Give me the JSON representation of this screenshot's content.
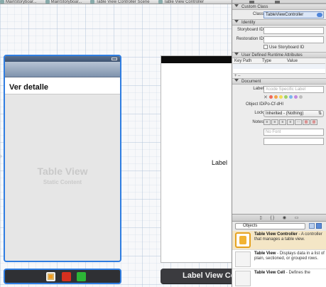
{
  "tabbar": {
    "items": [
      "MainStoryboar...",
      "MainStoryboar...",
      "Table View Controller Scene",
      "Table View Controller"
    ]
  },
  "scene1": {
    "cell_title": "Ver detalle",
    "placeholder_title": "Table View",
    "placeholder_subtitle": "Static Content"
  },
  "scene2": {
    "label_text": "Label",
    "dock_title": "Label View Con"
  },
  "inspector": {
    "custom_class": {
      "header": "Custom Class",
      "class_label": "Class",
      "class_value": "TableViewController"
    },
    "identity": {
      "header": "Identity",
      "storyboard_id_label": "Storyboard ID",
      "storyboard_id_value": "",
      "restoration_id_label": "Restoration ID",
      "restoration_id_value": "",
      "use_storyboard_id_label": "Use Storyboard ID"
    },
    "udra": {
      "header": "User Defined Runtime Attributes",
      "columns": [
        "Key Path",
        "Type",
        "Value"
      ],
      "add_remove": "+ –"
    },
    "document": {
      "header": "Document",
      "label_label": "Label",
      "label_placeholder": "Xcode Specific Label",
      "object_id_label": "Object ID",
      "object_id_value": "iPo-Cf-dHI",
      "lock_label": "Lock",
      "lock_value": "Inherited - (Nothing)",
      "notes_label": "Notes",
      "font_placeholder": "No Font",
      "label_colors": [
        "#f06a5a",
        "#f4a34a",
        "#f2dc55",
        "#9fd266",
        "#7ab4ef",
        "#c08ae0",
        "#bdbdbd"
      ]
    }
  },
  "library": {
    "filter_value": "Objects",
    "items": [
      {
        "name": "Table View Controller",
        "desc": " - A controller that manages a table view."
      },
      {
        "name": "Table View",
        "desc": " - Displays data in a list of plain, sectioned, or grouped rows."
      },
      {
        "name": "Table View Cell",
        "desc": " - Defines the"
      }
    ]
  }
}
